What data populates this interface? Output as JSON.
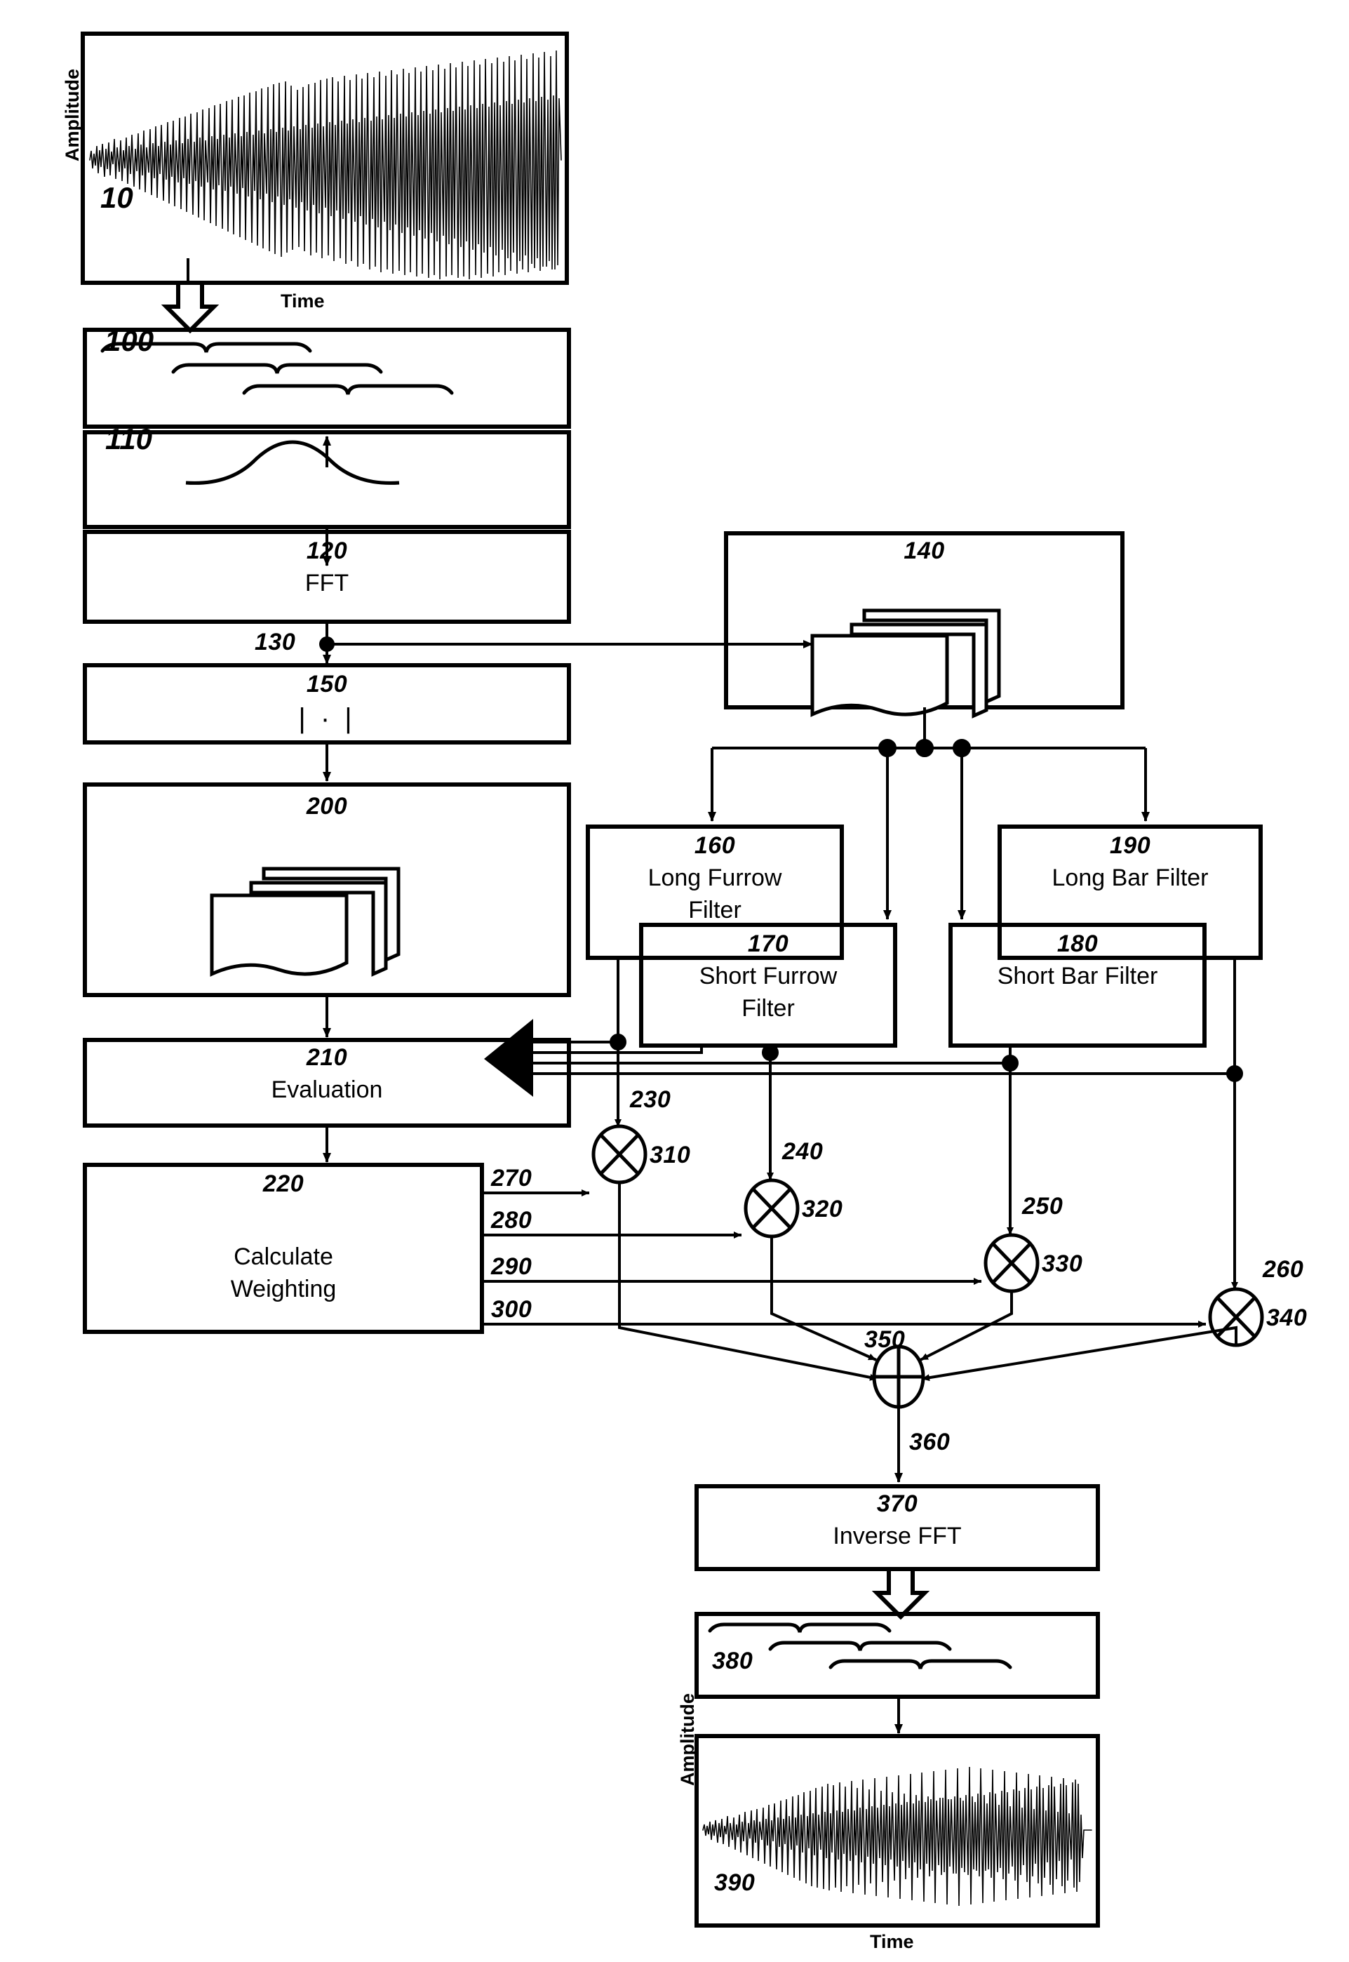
{
  "figure": {
    "type": "patent-flowchart",
    "title": "Signal processing flow diagram with furrow and bar filters"
  },
  "axes": {
    "amplitude_label": "Amplitude",
    "time_label": "Time"
  },
  "blocks": [
    {
      "id": "10",
      "ref": "10",
      "text": "",
      "icon": "noisy-waveform"
    },
    {
      "id": "100",
      "ref": "100",
      "text": "",
      "icon": "windowing-braces"
    },
    {
      "id": "110",
      "ref": "110",
      "text": "",
      "icon": "gaussian-bell-curve"
    },
    {
      "id": "120",
      "ref": "120",
      "text": "FFT",
      "icon": "none"
    },
    {
      "id": "140",
      "ref": "140",
      "text": "",
      "icon": "page-stack"
    },
    {
      "id": "150",
      "ref": "150",
      "text": "| · |",
      "icon": "absolute-value"
    },
    {
      "id": "160",
      "ref": "160",
      "text": "Long Furrow\nFilter",
      "line1": "Long Furrow",
      "line2": "Filter"
    },
    {
      "id": "170",
      "ref": "170",
      "line1": "Short Furrow",
      "line2": "Filter"
    },
    {
      "id": "180",
      "ref": "180",
      "line1": "Short Bar Filter",
      "line2": ""
    },
    {
      "id": "190",
      "ref": "190",
      "line1": "Long Bar Filter",
      "line2": ""
    },
    {
      "id": "200",
      "ref": "200",
      "text": "",
      "icon": "page-stack"
    },
    {
      "id": "210",
      "ref": "210",
      "text": "Evaluation",
      "icon": "none"
    },
    {
      "id": "220",
      "ref": "220",
      "line1": "Calculate",
      "line2": "Weighting"
    },
    {
      "id": "370",
      "ref": "370",
      "text": "Inverse FFT",
      "icon": "none"
    },
    {
      "id": "380",
      "ref": "380",
      "text": "",
      "icon": "windowing-braces"
    },
    {
      "id": "390",
      "ref": "390",
      "text": "",
      "icon": "noisy-waveform"
    }
  ],
  "signal_labels": [
    {
      "id": "130",
      "ref": "130"
    },
    {
      "id": "230",
      "ref": "230"
    },
    {
      "id": "240",
      "ref": "240"
    },
    {
      "id": "250",
      "ref": "250"
    },
    {
      "id": "260",
      "ref": "260"
    },
    {
      "id": "270",
      "ref": "270"
    },
    {
      "id": "280",
      "ref": "280"
    },
    {
      "id": "290",
      "ref": "290"
    },
    {
      "id": "300",
      "ref": "300"
    },
    {
      "id": "360",
      "ref": "360"
    }
  ],
  "operators": [
    {
      "id": "310",
      "ref": "310",
      "kind": "multiplier"
    },
    {
      "id": "320",
      "ref": "320",
      "kind": "multiplier"
    },
    {
      "id": "330",
      "ref": "330",
      "kind": "multiplier"
    },
    {
      "id": "340",
      "ref": "340",
      "kind": "multiplier"
    },
    {
      "id": "350",
      "ref": "350",
      "kind": "summer"
    }
  ],
  "colors": {
    "stroke": "#000000",
    "background": "#ffffff"
  }
}
